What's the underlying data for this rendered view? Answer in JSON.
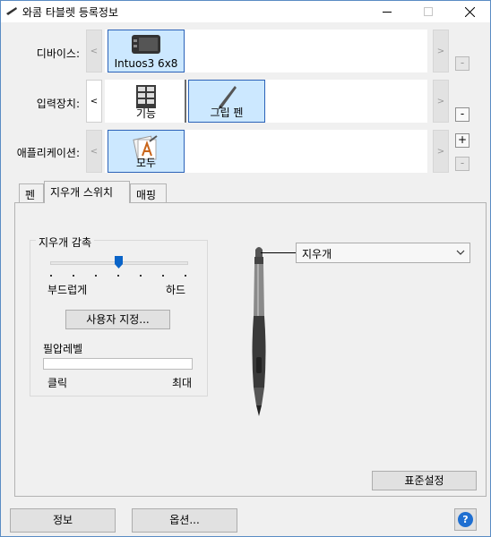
{
  "window": {
    "title": "와콤 타블렛 등록정보"
  },
  "rows": {
    "device": {
      "label": "디바이스:",
      "tile": "Intuos3 6x8"
    },
    "tool": {
      "label": "입력장치:",
      "tiles": [
        "기능",
        "그립 펜"
      ]
    },
    "app": {
      "label": "애플리케이션:",
      "tile": "모두"
    }
  },
  "nav": {
    "prev": "<",
    "next": ">",
    "plus": "+",
    "minus": "-"
  },
  "tabs": [
    "펜",
    "지우개 스위치",
    "매핑"
  ],
  "eraser": {
    "group_title": "지우개 감촉",
    "soft_label": "부드럽게",
    "hard_label": "하드",
    "customize_button": "사용자 지정...",
    "pressure_label": "필압레벨",
    "click_label": "클릭",
    "max_label": "최대",
    "feel_level": 0.5,
    "pressure_level": 0
  },
  "function_select": {
    "value": "지우개"
  },
  "defaults_button": "표준설정",
  "footer": {
    "about_button": "정보",
    "options_button": "옵션...",
    "help_icon": "?"
  },
  "colors": {
    "accent": "#2b62b8",
    "selected_bg": "#cce8ff"
  }
}
